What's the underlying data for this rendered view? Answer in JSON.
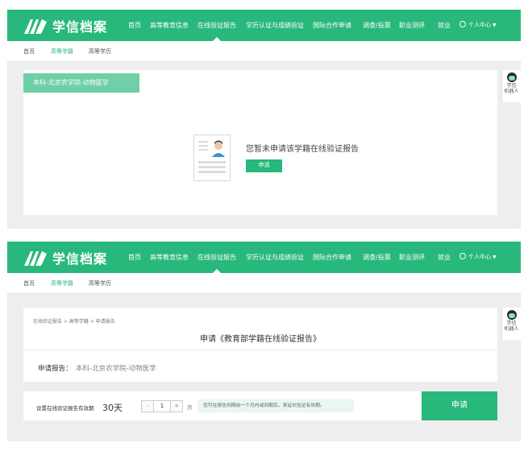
{
  "brand": {
    "name": "学信档案",
    "color": "#28b87b"
  },
  "nav": {
    "items": [
      "首页",
      "高等教育信息",
      "在线验证报告",
      "学历认证与成绩验证",
      "国际合作申请",
      "调查/投票",
      "职业测评",
      "就业"
    ],
    "active_index": 2,
    "user_menu": "个人中心"
  },
  "subnav": {
    "items": [
      "首页",
      "高等学籍",
      "高等学历"
    ],
    "current_index": 1
  },
  "robot": {
    "line1": "学信",
    "line2": "机器人"
  },
  "screen1": {
    "ribbon": "本科-北京农学院-动物医学",
    "empty_message": "您暂未申请该学籍在线验证报告",
    "apply_button": "申请"
  },
  "screen2": {
    "breadcrumb": "在线验证报告 > 高等学籍 > 申请报告",
    "title": "申请《教育部学籍在线验证报告》",
    "report_label": "申请报告：",
    "report_value": "本科-北京农学院-动物医学",
    "period_label": "设置在线验证报告有效期",
    "period_value": "30天",
    "stepper": {
      "minus": "-",
      "value": "1",
      "plus": "+"
    },
    "unit": "月",
    "hint": "您可在报告到期前一个月内或到期后，来延长验证有效期。",
    "submit_button": "申请"
  }
}
